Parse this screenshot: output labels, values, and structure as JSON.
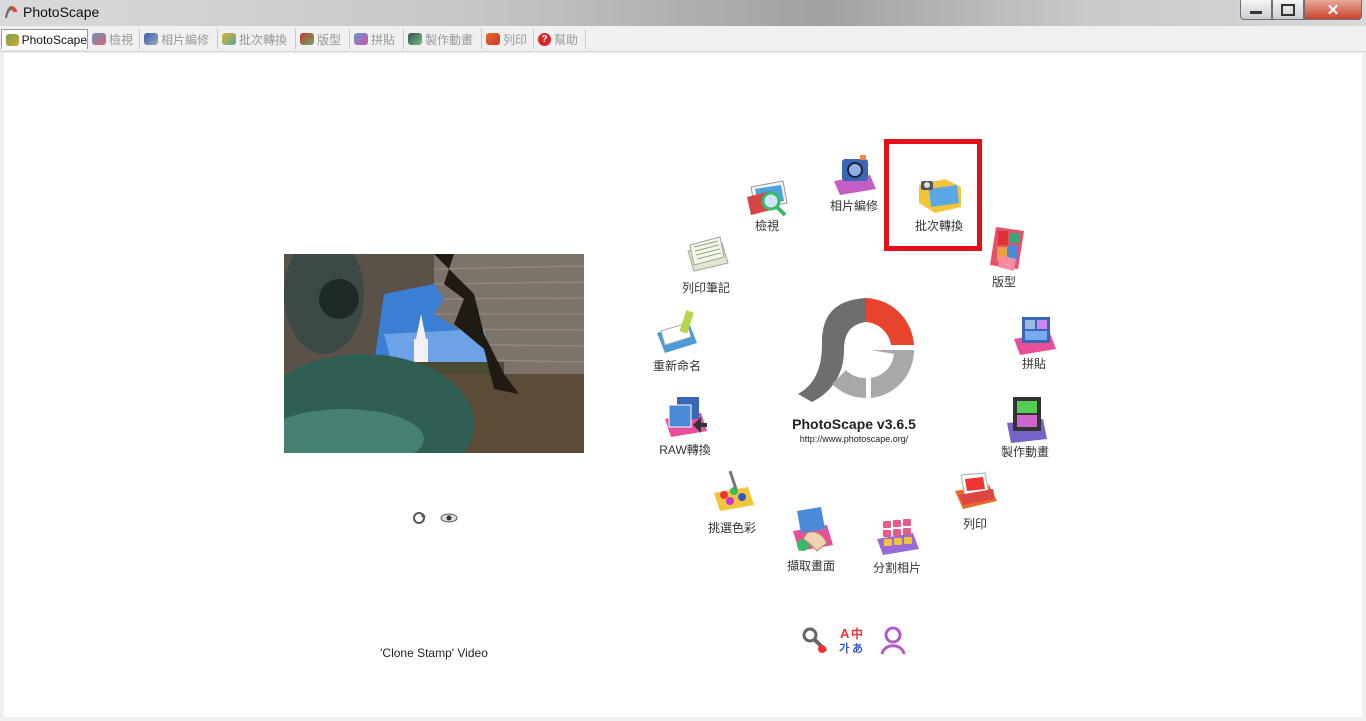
{
  "window": {
    "title": "PhotoScape"
  },
  "tabs": [
    {
      "label": "PhotoScape",
      "active": true
    },
    {
      "label": "檢視"
    },
    {
      "label": "相片編修"
    },
    {
      "label": "批次轉換"
    },
    {
      "label": "版型"
    },
    {
      "label": "拼貼"
    },
    {
      "label": "製作動畫"
    },
    {
      "label": "列印"
    },
    {
      "label": "幫助"
    }
  ],
  "photo": {
    "caption": "'Clone Stamp' Video"
  },
  "center": {
    "version": "PhotoScape v3.6.5",
    "url": "http://www.photoscape.org/"
  },
  "menu": {
    "viewer": "檢視",
    "editor": "相片編修",
    "batch": "批次轉換",
    "page": "版型",
    "combine": "拼貼",
    "animated": "製作動畫",
    "print": "列印",
    "splitter": "分割相片",
    "screen_capture": "擷取畫面",
    "color_picker": "挑選色彩",
    "raw_converter": "RAW轉換",
    "rename": "重新命名",
    "paper_print": "列印筆記"
  },
  "colors": {
    "highlight": "#e3101b",
    "logo_red": "#e8432d",
    "logo_dark": "#6e6e6e",
    "logo_gray": "#a8a8a8"
  }
}
